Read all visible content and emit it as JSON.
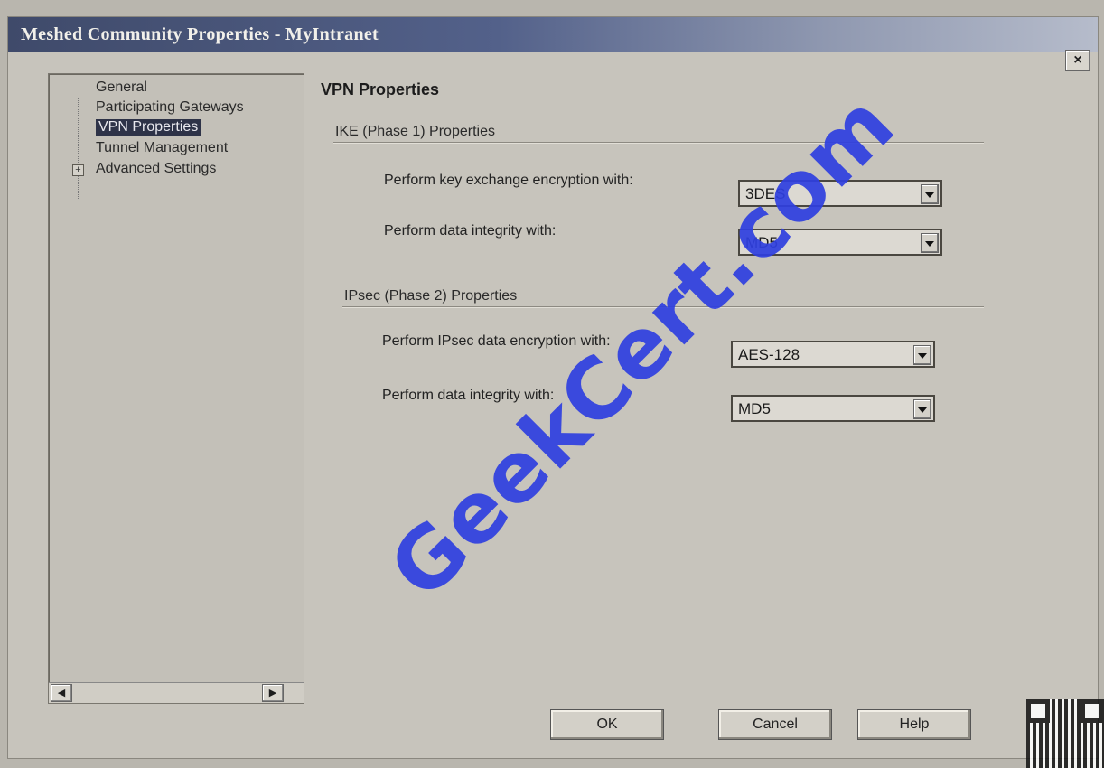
{
  "window": {
    "title": "Meshed Community Properties - MyIntranet",
    "close_label": "×"
  },
  "tree": {
    "items": [
      {
        "label": "General"
      },
      {
        "label": "Participating Gateways"
      },
      {
        "label": "VPN Properties"
      },
      {
        "label": "Tunnel Management"
      },
      {
        "label": "Advanced Settings",
        "expander": "+"
      }
    ],
    "scroll_left": "◀",
    "scroll_right": "▶"
  },
  "content": {
    "section_title": "VPN Properties",
    "ike": {
      "group_label": "IKE (Phase 1) Properties",
      "encryption_label": "Perform key exchange encryption with:",
      "encryption_value": "3DES",
      "integrity_label": "Perform data integrity with:",
      "integrity_value": "MD5"
    },
    "ipsec": {
      "group_label": "IPsec (Phase 2) Properties",
      "encryption_label": "Perform IPsec data encryption with:",
      "encryption_value": "AES-128",
      "integrity_label": "Perform data integrity with:",
      "integrity_value": "MD5"
    }
  },
  "buttons": {
    "ok": "OK",
    "cancel": "Cancel",
    "help": "Help"
  },
  "watermark": "GeekCert.com"
}
